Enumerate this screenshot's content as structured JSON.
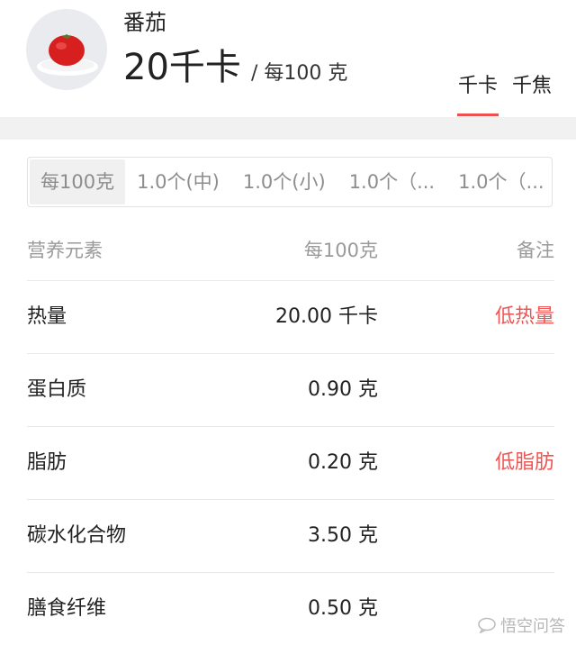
{
  "food": {
    "name": "番茄",
    "calories": "20千卡",
    "calories_unit": "/ 每100 克"
  },
  "unit_tabs": [
    {
      "label": "千卡",
      "active": true
    },
    {
      "label": "千焦",
      "active": false
    }
  ],
  "serving_options": [
    {
      "label": "每100克",
      "active": true
    },
    {
      "label": "1.0个(中)",
      "active": false
    },
    {
      "label": "1.0个(小)",
      "active": false
    },
    {
      "label": "1.0个（...",
      "active": false
    },
    {
      "label": "1.0个（...",
      "active": false
    }
  ],
  "table": {
    "headers": {
      "name": "营养元素",
      "amount": "每100克",
      "note": "备注"
    },
    "rows": [
      {
        "name": "热量",
        "amount": "20.00 千卡",
        "note": "低热量"
      },
      {
        "name": "蛋白质",
        "amount": "0.90 克",
        "note": ""
      },
      {
        "name": "脂肪",
        "amount": "0.20 克",
        "note": "低脂肪"
      },
      {
        "name": "碳水化合物",
        "amount": "3.50 克",
        "note": ""
      },
      {
        "name": "膳食纤维",
        "amount": "0.50 克",
        "note": ""
      }
    ]
  },
  "watermark": "悟空问答",
  "colors": {
    "accent": "#ee4f4f",
    "note_red": "#ee5555"
  }
}
